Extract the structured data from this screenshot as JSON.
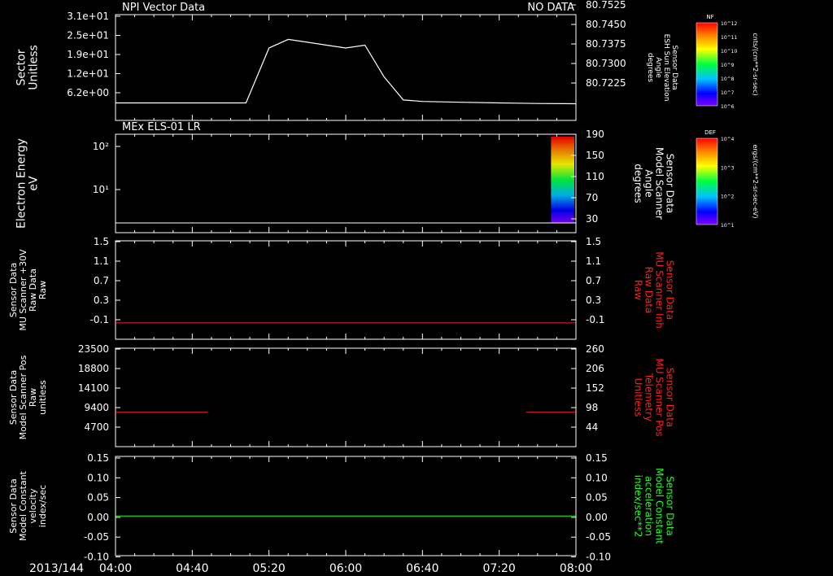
{
  "time_axis": {
    "date_label": "2013/144",
    "ticks": [
      "04:00",
      "04:40",
      "05:20",
      "06:00",
      "06:40",
      "07:20",
      "08:00"
    ],
    "range": [
      "04:00",
      "08:00"
    ]
  },
  "panels": [
    {
      "id": "sector",
      "title_left": "NPI Vector Data",
      "title_right": "NO DATA",
      "ylabel_left": [
        "Sector",
        "Unitless"
      ],
      "yticks_left": [
        "3.1e+01",
        "2.5e+01",
        "1.9e+01",
        "1.2e+01",
        "6.2e+00"
      ],
      "ylabel_right": [
        "Sensor Data",
        "ESH Sun Elevation",
        "Angle",
        "degrees"
      ],
      "yticks_right": [
        "80.7525",
        "80.7450",
        "80.7375",
        "80.7300",
        "80.7225"
      ],
      "right_label_color": "#ffffff",
      "colorbar": {
        "title": "NF",
        "ticks": [
          "10^12",
          "10^11",
          "10^10",
          "10^9",
          "10^8",
          "10^7",
          "10^6"
        ],
        "unit": "cnts/(cm**2-sr-sec)"
      }
    },
    {
      "id": "electron",
      "title_left": "MEx ELS-01 LR",
      "ylabel_left": [
        "Electron Energy",
        "eV"
      ],
      "yticks_left": [
        "10^2",
        "10^1"
      ],
      "ylabel_right": [
        "Sensor Data",
        "Model Scanner",
        "Angle",
        "degrees"
      ],
      "yticks_right": [
        "190",
        "150",
        "110",
        "70",
        "30"
      ],
      "right_label_color": "#ffffff",
      "colorbar": {
        "title": "DEF",
        "ticks": [
          "10^4",
          "10^3",
          "10^2",
          "10^1"
        ],
        "unit": "ergs/(cm**2-sr-sec-eV)"
      }
    },
    {
      "id": "mu_raw",
      "ylabel_left": [
        "Sensor Data",
        "MU Scanner +30V",
        "Raw Data",
        "Raw"
      ],
      "yticks_left": [
        "1.5",
        "1.1",
        "0.7",
        "0.3",
        "-0.1"
      ],
      "ylabel_right": [
        "Sensor Data",
        "MU Scanner Inh",
        "Raw Data",
        "Raw"
      ],
      "yticks_right": [
        "1.5",
        "1.1",
        "0.7",
        "0.3",
        "-0.1"
      ],
      "right_label_color": "#ff2020"
    },
    {
      "id": "scanner_pos",
      "ylabel_left": [
        "Sensor Data",
        "Model Scanner Pos",
        "Raw",
        "unitless"
      ],
      "yticks_left": [
        "23500",
        "18800",
        "14100",
        "9400",
        "4700"
      ],
      "ylabel_right": [
        "Sensor Data",
        "MU Scanner Pos",
        "Telemetry",
        "Unitless"
      ],
      "yticks_right": [
        "260",
        "206",
        "152",
        "98",
        "44"
      ],
      "right_label_color": "#ff2020"
    },
    {
      "id": "velocity",
      "ylabel_left": [
        "Sensor Data",
        "Model Constant",
        "velocity",
        "index/sec"
      ],
      "yticks_left": [
        "0.15",
        "0.10",
        "0.05",
        "0.00",
        "-0.05",
        "-0.10"
      ],
      "ylabel_right": [
        "Sensor Data",
        "Model Constant",
        "acceleration",
        "index/sec**2"
      ],
      "yticks_right": [
        "0.15",
        "0.10",
        "0.05",
        "0.00",
        "-0.05",
        "-0.10"
      ],
      "right_label_color": "#20ff20"
    }
  ],
  "chart_data": [
    {
      "type": "line",
      "title": "NPI Vector Data",
      "note": "NO DATA",
      "ylabel": "Sector Unitless",
      "x": [
        "04:00",
        "04:20",
        "04:40",
        "05:00",
        "05:08",
        "05:20",
        "05:30",
        "05:40",
        "05:50",
        "06:00",
        "06:10",
        "06:20",
        "06:30",
        "06:40",
        "07:00",
        "07:20",
        "07:40",
        "08:00"
      ],
      "series": [
        {
          "values": [
            1,
            1,
            1,
            1,
            1,
            20,
            23,
            22,
            21,
            20,
            21,
            10,
            2,
            1.5,
            1.2,
            1,
            0.8,
            0.7
          ]
        }
      ],
      "ylim": [
        0,
        31
      ],
      "color": "#ffffff"
    },
    {
      "type": "heatmap",
      "title": "MEx ELS-01 LR",
      "ylabel": "Electron Energy eV",
      "x_range": [
        "07:47",
        "08:00"
      ],
      "yscale": "log",
      "line": {
        "y": 1.5,
        "color": "#ffffff"
      }
    },
    {
      "type": "line",
      "ylabel": "Sensor Data MU Scanner +30V Raw Data Raw",
      "x": [
        "04:00",
        "08:00"
      ],
      "series": [
        {
          "values": [
            0,
            0
          ]
        }
      ],
      "ylim": [
        -0.3,
        1.5
      ],
      "color": "#ff2020"
    },
    {
      "type": "line",
      "ylabel": "Sensor Data Model Scanner Pos Raw unitless",
      "segments": [
        {
          "x": [
            "04:00",
            "04:48"
          ],
          "y": [
            8200,
            8200
          ]
        },
        {
          "x": [
            "07:34",
            "08:00"
          ],
          "y": [
            8200,
            8200
          ]
        }
      ],
      "ylim": [
        0,
        23500
      ],
      "color": "#ff2020"
    },
    {
      "type": "line",
      "ylabel": "Sensor Data Model Constant velocity index/sec",
      "x": [
        "04:00",
        "08:00"
      ],
      "series": [
        {
          "values": [
            0,
            0
          ]
        }
      ],
      "ylim": [
        -0.1,
        0.15
      ],
      "color": "#20ff20"
    }
  ]
}
